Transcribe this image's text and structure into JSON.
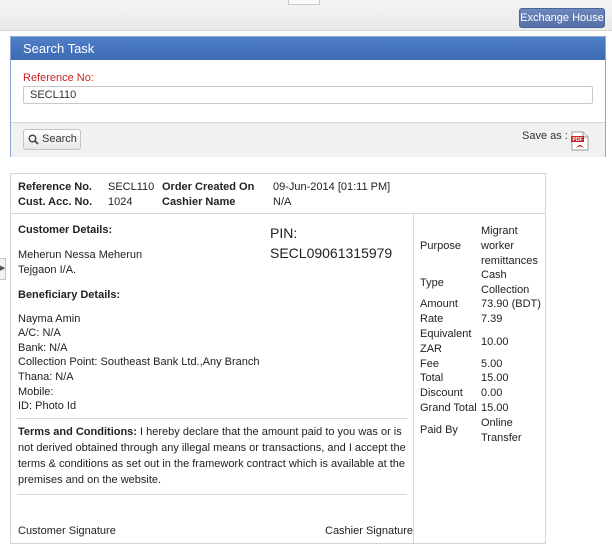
{
  "header": {
    "exchange_house_label": "Exchange House"
  },
  "search_task": {
    "title": "Search Task",
    "reference_label": "Reference No:",
    "reference_value": "SECL110",
    "search_button": "Search",
    "save_as_label": "Save as :",
    "pdf_icon": "pdf-file-icon",
    "pdf_icon_text": "PDF"
  },
  "receipt": {
    "reference_label": "Reference No.",
    "reference_value": "SECL110",
    "order_created_label": "Order Created On",
    "order_created_value": "09-Jun-2014 [01:11 PM]",
    "cust_acc_label": "Cust. Acc. No.",
    "cust_acc_value": "1024",
    "cashier_label": "Cashier Name",
    "cashier_value": "N/A",
    "customer_heading": "Customer Details:",
    "customer_name": "Meherun Nessa Meherun",
    "customer_address": "Tejgaon I/A.",
    "pin_label": "PIN:",
    "pin_value": "SECL09061315979",
    "beneficiary_heading": "Beneficiary Details:",
    "beneficiary_name": "Nayma Amin",
    "beneficiary_ac": "A/C: N/A",
    "beneficiary_bank": "Bank: N/A",
    "collection_point": "Collection Point: Southeast Bank Ltd.,Any Branch",
    "thana": "Thana: N/A",
    "mobile": "Mobile:",
    "id": "ID: Photo Id",
    "terms_label": "Terms and Conditions:",
    "terms_text": "I hereby declare that the amount paid to you was or is not derived obtained through any illegal means or transactions, and I accept the terms & conditions as set out in the framework contract which is available at the premises and on the website.",
    "customer_signature": "Customer Signature",
    "cashier_signature": "Cashier Signature",
    "details": {
      "purpose_label": "Purpose",
      "purpose_lines": [
        "Migrant",
        "worker",
        "remittances"
      ],
      "type_label": "Type",
      "type_lines": [
        "Cash",
        "Collection"
      ],
      "amount_label": "Amount",
      "amount_value": "73.90 (BDT)",
      "rate_label": "Rate",
      "rate_value": "7.39",
      "equivalent_lines": [
        "Equivalent",
        "ZAR"
      ],
      "equivalent_value": "10.00",
      "fee_label": "Fee",
      "fee_value": "5.00",
      "total_label": "Total",
      "total_value": "15.00",
      "discount_label": "Discount",
      "discount_value": "0.00",
      "grand_total_label": "Grand Total",
      "grand_total_value": "15.00",
      "paid_by_label": "Paid By",
      "paid_by_lines": [
        "Online",
        "Transfer"
      ]
    }
  }
}
